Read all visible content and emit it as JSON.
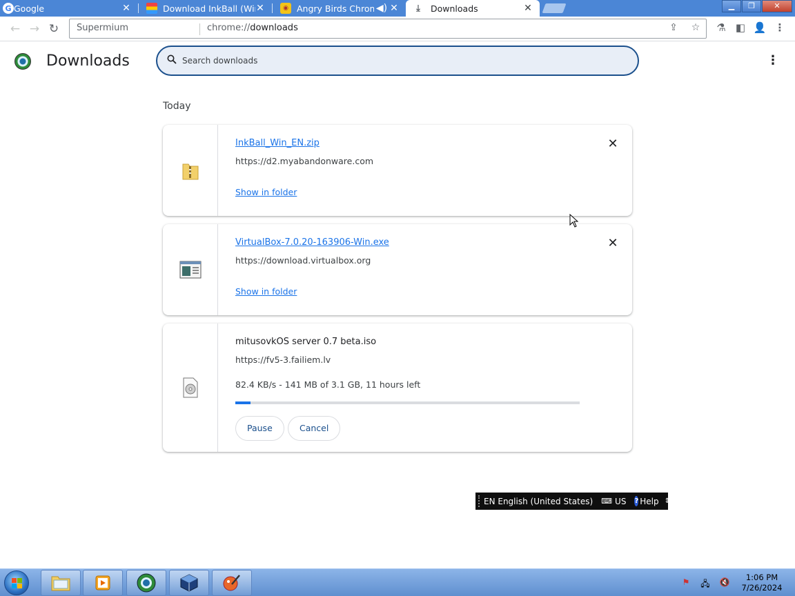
{
  "tabs": [
    {
      "title": "Google",
      "icon": "google-g-icon",
      "state": "inactive"
    },
    {
      "title": "Download InkBall (Win",
      "icon": "myabandonware-icon",
      "state": "inactive"
    },
    {
      "title": "Angry Birds Chrom",
      "icon": "angry-birds-icon",
      "state": "inactive",
      "audio": true
    },
    {
      "title": "Downloads",
      "icon": "download-icon",
      "state": "active"
    }
  ],
  "toolbar": {
    "origin": "Supermium",
    "url_scheme": "chrome://",
    "url_path": "downloads"
  },
  "page": {
    "title": "Downloads",
    "search_placeholder": "Search downloads",
    "date_header": "Today"
  },
  "downloads": [
    {
      "file_name": "InkBall_Win_EN.zip",
      "source": "https://d2.myabandonware.com",
      "action_label": "Show in folder",
      "icon": "zip-folder-icon",
      "state": "complete"
    },
    {
      "file_name": "VirtualBox-7.0.20-163906-Win.exe",
      "source": "https://download.virtualbox.org",
      "action_label": "Show in folder",
      "icon": "exe-file-icon",
      "state": "complete"
    },
    {
      "file_name": "mitusovkOS server 0.7 beta.iso",
      "source": "https://fv5-3.failiem.lv",
      "progress_text": "82.4 KB/s - 141 MB of 3.1 GB, 11 hours left",
      "progress_fraction": 0.045,
      "pause_label": "Pause",
      "cancel_label": "Cancel",
      "icon": "iso-disc-icon",
      "state": "in-progress"
    }
  ],
  "language_bar": {
    "language": "EN English (United States)",
    "keyboard": "US",
    "help": "Help"
  },
  "taskbar": {
    "apps": [
      "explorer",
      "media-player",
      "supermium",
      "virtualbox",
      "paint"
    ],
    "time": "1:06 PM",
    "date": "7/26/2024"
  },
  "colors": {
    "accent": "#1a73e8",
    "titlebar": "#4b86d6",
    "search_border": "#1a4f8c"
  }
}
